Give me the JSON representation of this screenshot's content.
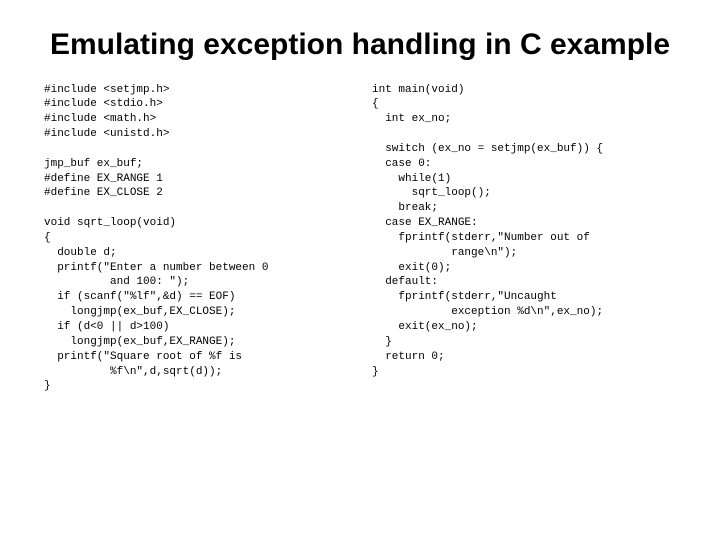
{
  "title": "Emulating exception handling in C example",
  "code_left": "#include <setjmp.h>\n#include <stdio.h>\n#include <math.h>\n#include <unistd.h>\n\njmp_buf ex_buf;\n#define EX_RANGE 1\n#define EX_CLOSE 2\n\nvoid sqrt_loop(void)\n{\n  double d;\n  printf(\"Enter a number between 0\n          and 100: \");\n  if (scanf(\"%lf\",&d) == EOF)\n    longjmp(ex_buf,EX_CLOSE);\n  if (d<0 || d>100)\n    longjmp(ex_buf,EX_RANGE);\n  printf(\"Square root of %f is\n          %f\\n\",d,sqrt(d));\n}",
  "code_right": "int main(void)\n{\n  int ex_no;\n\n  switch (ex_no = setjmp(ex_buf)) {\n  case 0:\n    while(1)\n      sqrt_loop();\n    break;\n  case EX_RANGE:\n    fprintf(stderr,\"Number out of\n            range\\n\");\n    exit(0);\n  default:\n    fprintf(stderr,\"Uncaught\n            exception %d\\n\",ex_no);\n    exit(ex_no);\n  }\n  return 0;\n}"
}
